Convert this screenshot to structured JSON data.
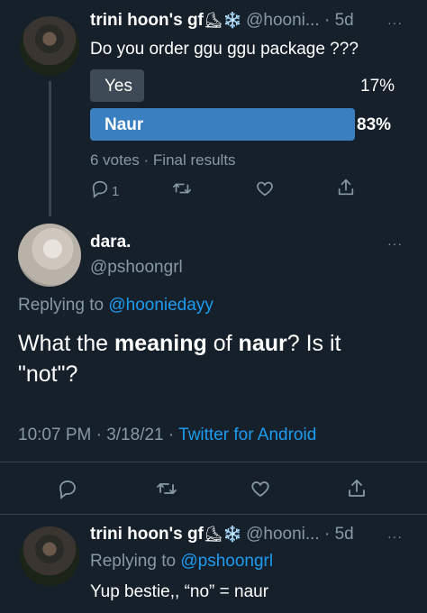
{
  "tweet1": {
    "name": "trini hoon's gf",
    "emoji": "⛸❄️",
    "handle_time": "@hooni... · 5d",
    "text": "Do you order ggu ggu package ???",
    "poll": {
      "options": [
        {
          "label": "Yes",
          "percent": "17%",
          "fraction": 0.17
        },
        {
          "label": "Naur",
          "percent": "83%",
          "fraction": 0.83
        }
      ],
      "meta": "6 votes · Final results"
    },
    "reply_count": "1",
    "more": "···"
  },
  "tweet2": {
    "name": "dara.",
    "handle": "@pshoongrl",
    "replying_prefix": "Replying to ",
    "replying_to": "@hooniedayy",
    "text_parts": [
      "What the ",
      "meaning",
      " of ",
      "naur",
      "? Is it \"not\"?"
    ],
    "timestamp": "10:07 PM · 3/18/21 · ",
    "source": "Twitter for Android",
    "more": "···"
  },
  "tweet3": {
    "name": "trini hoon's gf",
    "emoji": "⛸❄️",
    "handle_time": "@hooni... · 5d",
    "replying_prefix": "Replying to ",
    "replying_to": "@pshoongrl",
    "text": "Yup bestie,, “no” = naur",
    "more": "···"
  },
  "colors": {
    "background": "#15202b",
    "muted": "#8899a6",
    "link": "#1d9bf0",
    "poll_winner": "#3a80c0",
    "poll_loser": "#3d4a55"
  },
  "icons": [
    "reply-icon",
    "retweet-icon",
    "like-icon",
    "share-icon",
    "more-icon"
  ]
}
